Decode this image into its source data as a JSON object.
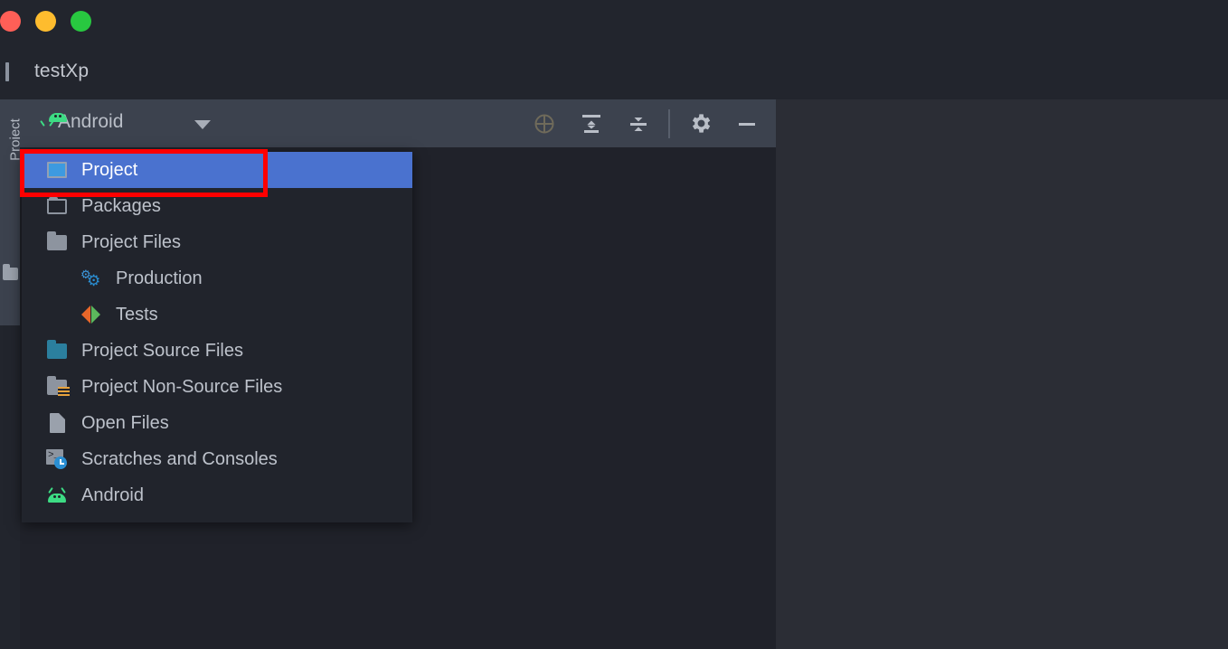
{
  "window": {
    "traffic_lights": [
      {
        "name": "close",
        "color": "#ff5f57"
      },
      {
        "name": "minimize",
        "color": "#febc2e"
      },
      {
        "name": "zoom",
        "color": "#28c840"
      }
    ],
    "project_title": "testXp",
    "project_icon": "window-icon"
  },
  "tool_window_bar": {
    "label": "Project",
    "icon": "folder-icon"
  },
  "toolbar": {
    "view_selector_label": "Android",
    "view_selector_icon": "android-icon",
    "dropdown_icon": "chevron-down-icon",
    "actions": [
      {
        "name": "select-opened-file",
        "icon": "crosshair-icon",
        "label": "Select Opened File"
      },
      {
        "name": "expand-all",
        "icon": "expand-all-icon",
        "label": "Expand All"
      },
      {
        "name": "collapse-all",
        "icon": "collapse-all-icon",
        "label": "Collapse All"
      },
      {
        "name": "options",
        "icon": "gear-icon",
        "label": "Options"
      },
      {
        "name": "hide",
        "icon": "minimize-icon",
        "label": "Hide"
      }
    ]
  },
  "popup_menu": {
    "items": [
      {
        "label": "Project",
        "icon": "window-icon",
        "selected": true,
        "indent": false
      },
      {
        "label": "Packages",
        "icon": "folder-outline-icon",
        "selected": false,
        "indent": false
      },
      {
        "label": "Project Files",
        "icon": "folder-icon",
        "selected": false,
        "indent": false
      },
      {
        "label": "Production",
        "icon": "gears-icon",
        "selected": false,
        "indent": true
      },
      {
        "label": "Tests",
        "icon": "test-triangles-icon",
        "selected": false,
        "indent": true
      },
      {
        "label": "Project Source Files",
        "icon": "folder-teal-icon",
        "selected": false,
        "indent": false
      },
      {
        "label": "Project Non-Source Files",
        "icon": "folder-lines-icon",
        "selected": false,
        "indent": false
      },
      {
        "label": "Open Files",
        "icon": "document-icon",
        "selected": false,
        "indent": false
      },
      {
        "label": "Scratches and Consoles",
        "icon": "scratch-icon",
        "selected": false,
        "indent": false
      },
      {
        "label": "Android",
        "icon": "android-icon",
        "selected": false,
        "indent": false
      }
    ]
  },
  "annotation": {
    "type": "highlight-rectangle",
    "color": "#ff0000",
    "target": "Project"
  },
  "colors": {
    "titlebar_bg": "#22252d",
    "toolbar_bg": "#3c424e",
    "panel_bg": "#20222a",
    "popup_bg": "#21242c",
    "editor_bg": "#2b2d35",
    "selection_blue": "#4a72cf",
    "android_green": "#3ddc84",
    "accent_teal": "#2b7f9e",
    "text_primary": "#bdc2cb"
  }
}
